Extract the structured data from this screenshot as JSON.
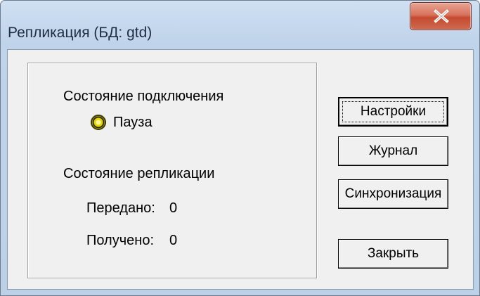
{
  "window": {
    "title": "Репликация (БД: gtd)"
  },
  "connection": {
    "heading": "Состояние подключения",
    "status": "Пауза",
    "status_color": "#e6d400"
  },
  "replication": {
    "heading": "Состояние репликации",
    "sent_label": "Передано:",
    "sent_value": "0",
    "received_label": "Получено:",
    "received_value": "0"
  },
  "buttons": {
    "settings": "Настройки",
    "journal": "Журнал",
    "sync": "Синхронизация",
    "close": "Закрыть"
  }
}
